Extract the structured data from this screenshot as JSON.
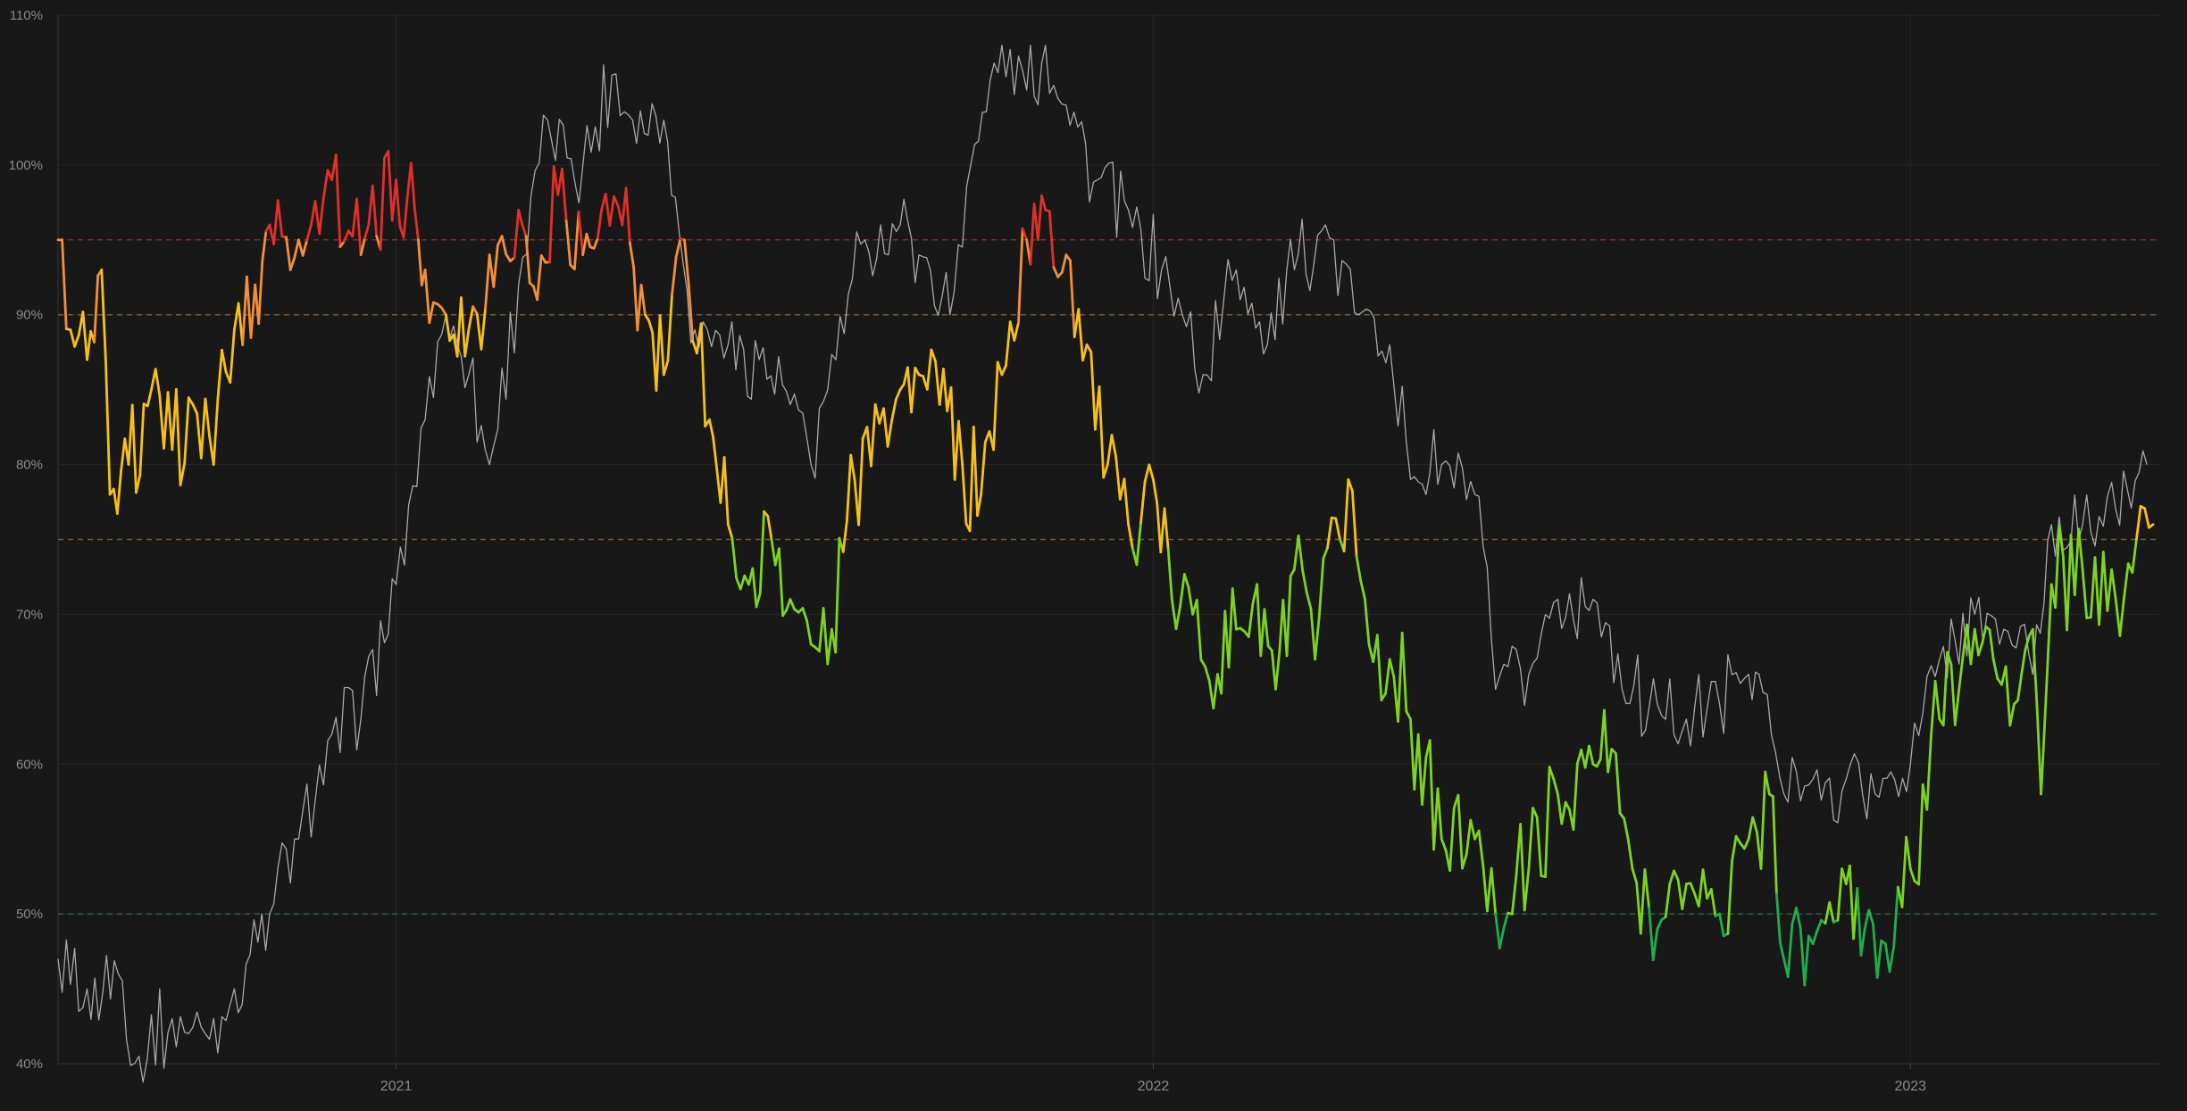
{
  "chart_data": {
    "type": "line",
    "title": "",
    "xlabel": "",
    "ylabel": "",
    "y_axis": {
      "min": 40,
      "max": 110,
      "step": 10,
      "unit": "%"
    },
    "y_ticks": [
      "110%",
      "100%",
      "90%",
      "80%",
      "70%",
      "60%",
      "50%",
      "40%"
    ],
    "x_axis": {
      "start": "2020-07-22",
      "end": "2023-05-01"
    },
    "x_ticks": [
      {
        "date": "2021-01-01",
        "label": "2021"
      },
      {
        "date": "2022-01-01",
        "label": "2022"
      },
      {
        "date": "2023-01-01",
        "label": "2023"
      }
    ],
    "grid": true,
    "reference_lines": [
      {
        "value": 95,
        "color": "#7a2e2a"
      },
      {
        "value": 90,
        "color": "#7a5a30"
      },
      {
        "value": 75,
        "color": "#7a5a30"
      },
      {
        "value": 50,
        "color": "#2f5f3a"
      }
    ],
    "color_bands": [
      {
        "from": 95,
        "to": 200,
        "color": "#e0302a"
      },
      {
        "from": 90,
        "to": 95,
        "color": "#f2903a"
      },
      {
        "from": 75,
        "to": 90,
        "color": "#f5c01a"
      },
      {
        "from": 50,
        "to": 75,
        "color": "#7ed321"
      },
      {
        "from": 0,
        "to": 50,
        "color": "#1fae4b"
      }
    ],
    "series": [
      {
        "style": "thin",
        "color": "#b8b8b8",
        "points": [
          [
            "2020-07-22",
            47
          ],
          [
            "2020-08-05",
            45
          ],
          [
            "2020-08-20",
            46
          ],
          [
            "2020-08-30",
            40.5
          ],
          [
            "2020-09-15",
            43
          ],
          [
            "2020-10-01",
            42
          ],
          [
            "2020-10-15",
            45
          ],
          [
            "2020-11-01",
            50
          ],
          [
            "2020-11-15",
            55
          ],
          [
            "2020-12-01",
            62
          ],
          [
            "2020-12-15",
            63
          ],
          [
            "2021-01-01",
            72
          ],
          [
            "2021-01-15",
            83
          ],
          [
            "2021-01-25",
            90
          ],
          [
            "2021-02-05",
            86
          ],
          [
            "2021-02-15",
            80
          ],
          [
            "2021-03-01",
            92
          ],
          [
            "2021-03-15",
            103
          ],
          [
            "2021-04-01",
            100
          ],
          [
            "2021-04-15",
            106
          ],
          [
            "2021-04-25",
            103
          ],
          [
            "2021-05-10",
            103
          ],
          [
            "2021-05-25",
            89
          ],
          [
            "2021-06-10",
            88
          ],
          [
            "2021-06-25",
            87
          ],
          [
            "2021-07-10",
            84
          ],
          [
            "2021-07-20",
            80
          ],
          [
            "2021-08-01",
            87
          ],
          [
            "2021-08-15",
            95
          ],
          [
            "2021-09-01",
            96
          ],
          [
            "2021-09-10",
            94
          ],
          [
            "2021-09-25",
            90
          ],
          [
            "2021-10-05",
            100
          ],
          [
            "2021-10-20",
            108
          ],
          [
            "2021-11-01",
            105
          ],
          [
            "2021-11-10",
            108
          ],
          [
            "2021-11-20",
            104
          ],
          [
            "2021-12-05",
            99
          ],
          [
            "2021-12-20",
            97
          ],
          [
            "2022-01-05",
            93
          ],
          [
            "2022-01-15",
            90
          ],
          [
            "2022-01-25",
            86
          ],
          [
            "2022-02-10",
            93
          ],
          [
            "2022-02-25",
            88
          ],
          [
            "2022-03-10",
            93
          ],
          [
            "2022-03-25",
            96
          ],
          [
            "2022-04-10",
            90
          ],
          [
            "2022-04-25",
            88
          ],
          [
            "2022-05-05",
            79
          ],
          [
            "2022-05-20",
            80
          ],
          [
            "2022-06-05",
            78
          ],
          [
            "2022-06-15",
            65
          ],
          [
            "2022-07-01",
            66
          ],
          [
            "2022-07-15",
            71
          ],
          [
            "2022-08-01",
            71
          ],
          [
            "2022-08-15",
            65
          ],
          [
            "2022-09-01",
            64
          ],
          [
            "2022-09-15",
            63
          ],
          [
            "2022-10-01",
            64
          ],
          [
            "2022-10-15",
            66
          ],
          [
            "2022-10-20",
            66
          ],
          [
            "2022-11-01",
            58
          ],
          [
            "2022-11-15",
            59
          ],
          [
            "2022-12-01",
            59
          ],
          [
            "2022-12-15",
            58
          ],
          [
            "2023-01-01",
            60
          ],
          [
            "2023-01-15",
            67
          ],
          [
            "2023-02-01",
            70
          ],
          [
            "2023-02-15",
            69
          ],
          [
            "2023-03-01",
            66
          ],
          [
            "2023-03-10",
            76
          ],
          [
            "2023-03-25",
            76
          ],
          [
            "2023-04-10",
            77
          ],
          [
            "2023-04-25",
            80
          ]
        ]
      },
      {
        "style": "thick",
        "color": "banded",
        "points": [
          [
            "2020-07-22",
            95
          ],
          [
            "2020-07-28",
            89
          ],
          [
            "2020-08-05",
            87
          ],
          [
            "2020-08-12",
            93
          ],
          [
            "2020-08-16",
            78
          ],
          [
            "2020-08-25",
            80
          ],
          [
            "2020-09-05",
            85
          ],
          [
            "2020-09-15",
            81
          ],
          [
            "2020-09-25",
            84
          ],
          [
            "2020-10-05",
            80
          ],
          [
            "2020-10-15",
            89
          ],
          [
            "2020-10-25",
            92
          ],
          [
            "2020-11-01",
            96
          ],
          [
            "2020-11-15",
            95
          ],
          [
            "2020-12-01",
            99
          ],
          [
            "2020-12-15",
            94
          ],
          [
            "2021-01-01",
            99
          ],
          [
            "2021-01-10",
            97
          ],
          [
            "2021-01-15",
            93
          ],
          [
            "2021-01-25",
            90
          ],
          [
            "2021-02-05",
            89
          ],
          [
            "2021-02-15",
            94
          ],
          [
            "2021-03-01",
            97
          ],
          [
            "2021-03-10",
            91
          ],
          [
            "2021-03-20",
            98
          ],
          [
            "2021-04-01",
            94
          ],
          [
            "2021-04-10",
            97
          ],
          [
            "2021-04-20",
            96
          ],
          [
            "2021-05-01",
            90
          ],
          [
            "2021-05-10",
            86
          ],
          [
            "2021-05-20",
            95
          ],
          [
            "2021-06-01",
            83
          ],
          [
            "2021-06-10",
            76
          ],
          [
            "2021-06-20",
            72
          ],
          [
            "2021-07-01",
            75
          ],
          [
            "2021-07-10",
            71
          ],
          [
            "2021-07-20",
            68
          ],
          [
            "2021-07-30",
            69
          ],
          [
            "2021-08-10",
            79
          ],
          [
            "2021-08-20",
            84
          ],
          [
            "2021-09-01",
            85
          ],
          [
            "2021-09-10",
            86
          ],
          [
            "2021-09-20",
            84
          ],
          [
            "2021-10-01",
            80
          ],
          [
            "2021-10-10",
            78
          ],
          [
            "2021-10-20",
            86
          ],
          [
            "2021-11-01",
            95
          ],
          [
            "2021-11-10",
            97
          ],
          [
            "2021-11-20",
            94
          ],
          [
            "2021-11-30",
            88
          ],
          [
            "2021-12-10",
            80
          ],
          [
            "2021-12-20",
            76
          ],
          [
            "2022-01-01",
            79
          ],
          [
            "2022-01-10",
            71
          ],
          [
            "2022-01-20",
            70
          ],
          [
            "2022-02-01",
            66
          ],
          [
            "2022-02-10",
            69
          ],
          [
            "2022-02-20",
            72
          ],
          [
            "2022-03-01",
            65
          ],
          [
            "2022-03-10",
            73
          ],
          [
            "2022-03-20",
            67
          ],
          [
            "2022-04-01",
            75
          ],
          [
            "2022-04-05",
            79
          ],
          [
            "2022-04-15",
            68
          ],
          [
            "2022-04-25",
            67
          ],
          [
            "2022-05-05",
            63
          ],
          [
            "2022-05-20",
            55
          ],
          [
            "2022-06-05",
            55
          ],
          [
            "2022-06-15",
            50
          ],
          [
            "2022-07-01",
            53
          ],
          [
            "2022-07-15",
            58
          ],
          [
            "2022-08-01",
            60
          ],
          [
            "2022-08-10",
            61
          ],
          [
            "2022-08-20",
            53
          ],
          [
            "2022-09-01",
            49
          ],
          [
            "2022-09-15",
            52
          ],
          [
            "2022-10-01",
            50
          ],
          [
            "2022-10-15",
            55
          ],
          [
            "2022-10-25",
            58
          ],
          [
            "2022-11-01",
            47
          ],
          [
            "2022-11-15",
            48
          ],
          [
            "2022-12-01",
            52
          ],
          [
            "2022-12-10",
            49
          ],
          [
            "2022-12-20",
            48
          ],
          [
            "2023-01-01",
            53
          ],
          [
            "2023-01-15",
            63
          ],
          [
            "2023-02-01",
            69
          ],
          [
            "2023-02-10",
            67
          ],
          [
            "2023-02-20",
            64
          ],
          [
            "2023-03-01",
            69
          ],
          [
            "2023-03-05",
            58
          ],
          [
            "2023-03-10",
            72
          ],
          [
            "2023-03-25",
            73
          ],
          [
            "2023-04-10",
            71
          ],
          [
            "2023-04-20",
            75
          ],
          [
            "2023-04-28",
            76
          ]
        ]
      }
    ]
  }
}
